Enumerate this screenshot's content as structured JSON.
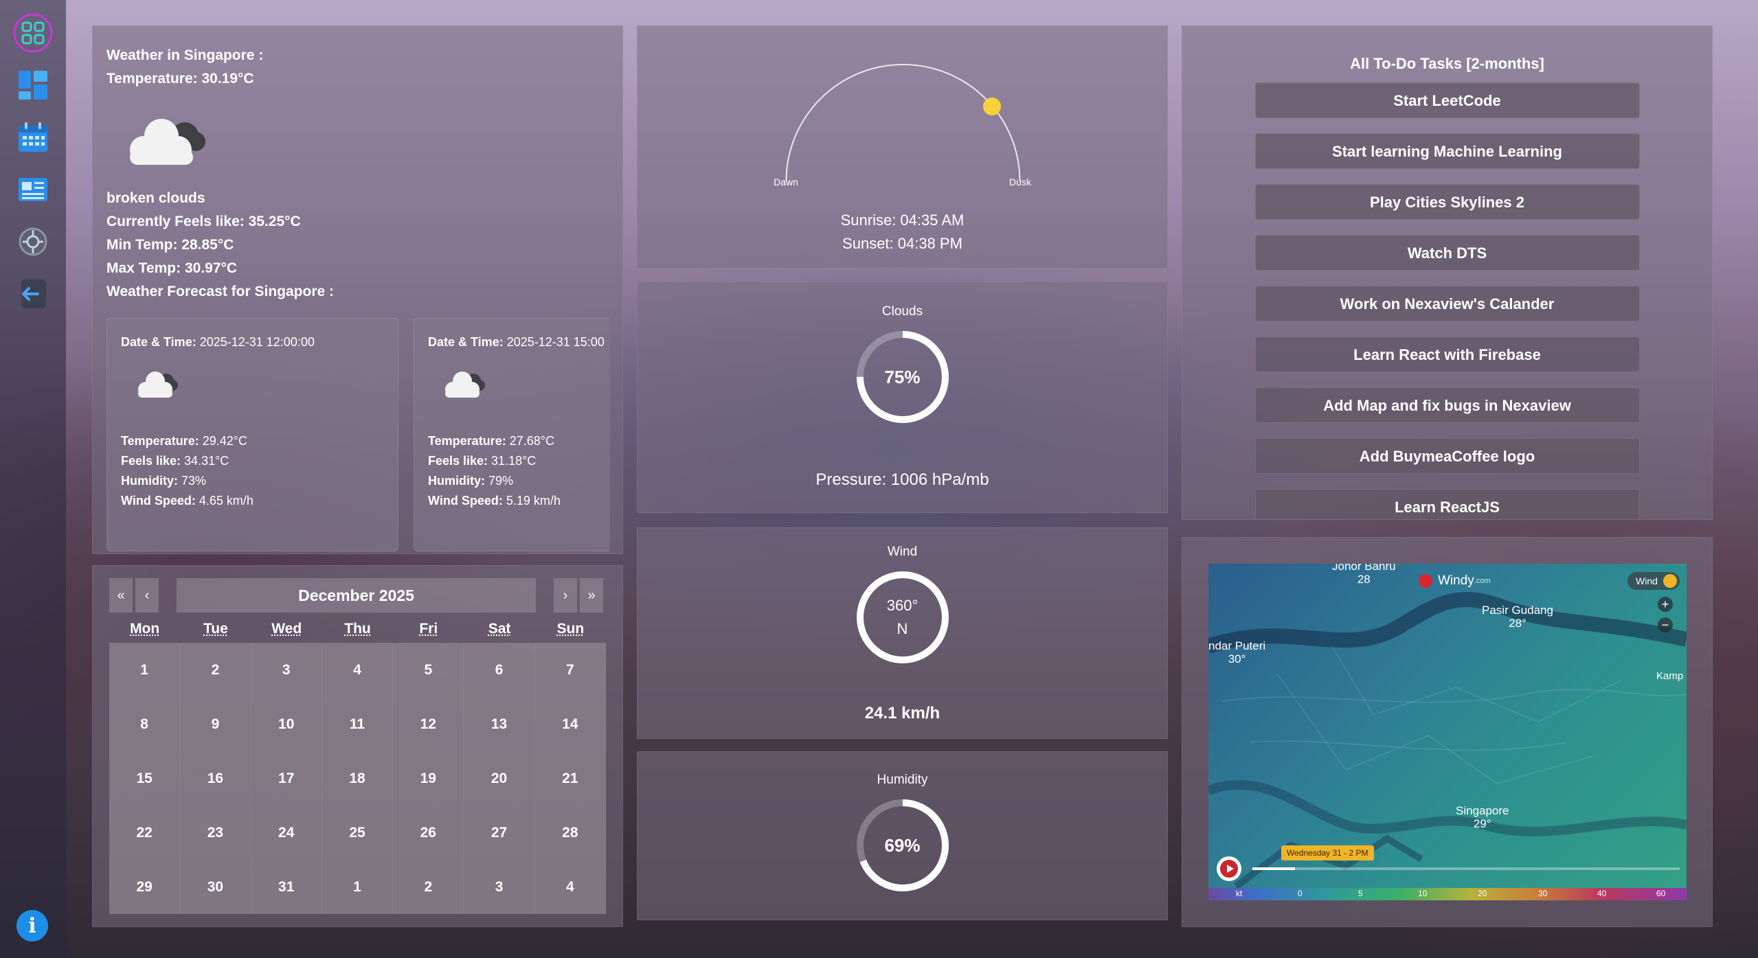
{
  "sidebar": {
    "items": [
      {
        "icon": "app-logo-icon"
      },
      {
        "icon": "dashboard-icon"
      },
      {
        "icon": "calendar-icon"
      },
      {
        "icon": "news-icon"
      },
      {
        "icon": "settings-icon"
      },
      {
        "icon": "logout-icon"
      }
    ],
    "info_label": "i"
  },
  "weather": {
    "title": "Weather in Singapore :",
    "temperature": "Temperature: 30.19°C",
    "description": "broken clouds",
    "feels_like": "Currently Feels like: 35.25°C",
    "min_temp": "Min Temp: 28.85°C",
    "max_temp": "Max Temp: 30.97°C",
    "forecast_title": "Weather Forecast for Singapore :",
    "forecast": [
      {
        "datetime_label": "Date & Time:",
        "datetime": " 2025-12-31 12:00:00",
        "temp_label": "Temperature:",
        "temp": " 29.42°C",
        "feels_label": "Feels like:",
        "feels": " 34.31°C",
        "humidity_label": "Humidity:",
        "humidity": " 73%",
        "wind_label": "Wind Speed:",
        "wind": " 4.65 km/h"
      },
      {
        "datetime_label": "Date & Time:",
        "datetime": " 2025-12-31 15:00",
        "temp_label": "Temperature:",
        "temp": " 27.68°C",
        "feels_label": "Feels like:",
        "feels": " 31.18°C",
        "humidity_label": "Humidity:",
        "humidity": " 79%",
        "wind_label": "Wind Speed:",
        "wind": " 5.19 km/h"
      }
    ]
  },
  "calendar": {
    "nav": {
      "prev_year": "«",
      "prev_month": "‹",
      "next_month": "›",
      "next_year": "»"
    },
    "month_label": "December 2025",
    "weekdays": [
      "Mon",
      "Tue",
      "Wed",
      "Thu",
      "Fri",
      "Sat",
      "Sun"
    ],
    "days": [
      "1",
      "2",
      "3",
      "4",
      "5",
      "6",
      "7",
      "8",
      "9",
      "10",
      "11",
      "12",
      "13",
      "14",
      "15",
      "16",
      "17",
      "18",
      "19",
      "20",
      "21",
      "22",
      "23",
      "24",
      "25",
      "26",
      "27",
      "28",
      "29",
      "30",
      "31",
      "1",
      "2",
      "3",
      "4"
    ]
  },
  "sun": {
    "dawn_label": "Dawn",
    "dusk_label": "Dusk",
    "sunrise": "Sunrise: 04:35 AM",
    "sunset": "Sunset: 04:38 PM",
    "sun_color": "#f7d23a"
  },
  "clouds": {
    "label": "Clouds",
    "percent_text": "75%",
    "percent": 75,
    "pressure": "Pressure: 1006 hPa/mb"
  },
  "wind": {
    "label": "Wind",
    "degrees": "360°",
    "direction": "N",
    "speed": "24.1 km/h"
  },
  "humidity": {
    "label": "Humidity",
    "percent_text": "69%",
    "percent": 69
  },
  "todo": {
    "title": "All To-Do Tasks [2-months]",
    "tasks": [
      "Start LeetCode",
      "Start learning Machine Learning",
      "Play Cities Skylines 2",
      "Watch DTS",
      "Work on Nexaview's Calander",
      "Learn React with Firebase",
      "Add Map and fix bugs in Nexaview",
      "Add BuymeaCoffee logo",
      "Learn ReactJS"
    ]
  },
  "map": {
    "brand": "Windy",
    "brand_suffix": ".com",
    "layer_label": "Wind",
    "zoom_in": "+",
    "zoom_out": "−",
    "places": [
      {
        "name": "Johor Bahru",
        "value": "28"
      },
      {
        "name": "Pasir Gudang",
        "value": "28°"
      },
      {
        "name": "ndar Puteri",
        "value": "30°"
      },
      {
        "name": "Kamp",
        "value": ""
      },
      {
        "name": "Singapore",
        "value": "29°"
      }
    ],
    "timeline_label": "Wednesday 31 - 2 PM",
    "scale_unit": "kt",
    "scale_values": [
      "0",
      "5",
      "10",
      "20",
      "30",
      "40",
      "60"
    ]
  }
}
